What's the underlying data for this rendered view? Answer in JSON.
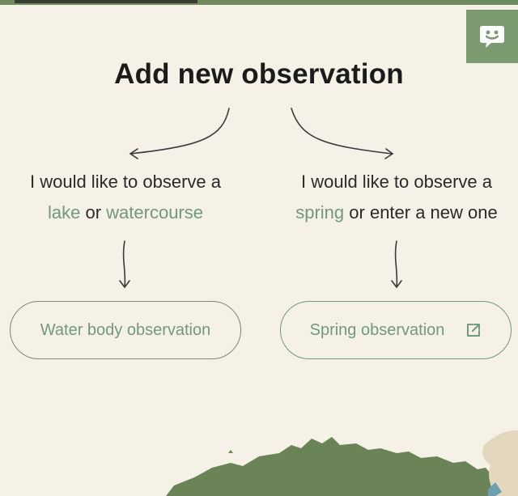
{
  "header": {
    "title": "Add new observation",
    "feedback_icon": "smile-chat-icon"
  },
  "choices": {
    "left": {
      "line1": "I would like to observe a",
      "highlight1": "lake",
      "connector": "or",
      "highlight2": "watercourse"
    },
    "right": {
      "line1": "I would like to observe a",
      "highlight1": "spring",
      "rest": "or enter a new one"
    }
  },
  "buttons": {
    "water_body": "Water body observation",
    "spring": "Spring observation",
    "spring_icon": "external-link-icon"
  },
  "colors": {
    "background": "#f6f1e7",
    "accent_green": "#6f9a7e",
    "feedback_bg": "#7c9a70",
    "map_green": "#6b8457"
  }
}
